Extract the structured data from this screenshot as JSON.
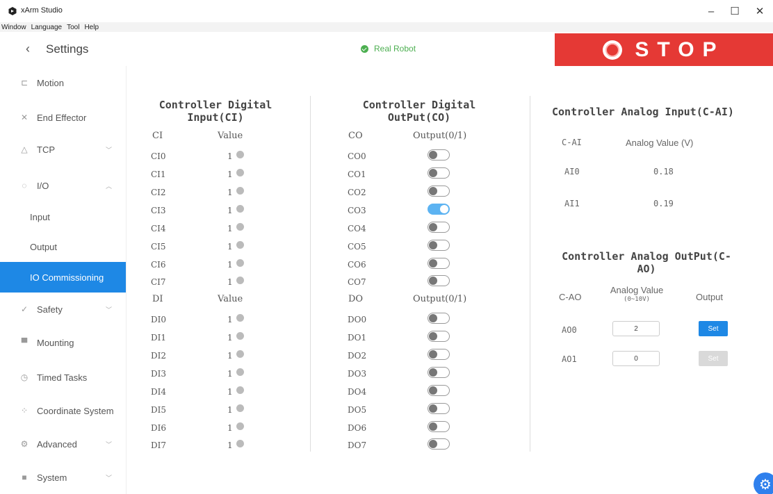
{
  "window": {
    "title": "xArm Studio",
    "min": "–",
    "max": "☐",
    "close": "✕"
  },
  "menu": [
    "Window",
    "Language",
    "Tool",
    "Help"
  ],
  "header": {
    "back": "‹",
    "title": "Settings",
    "status": "Real Robot",
    "stop_label": "STOP"
  },
  "colors": {
    "accent": "#1e88e5",
    "stop": "#e53935",
    "status_ok": "#4caf50",
    "toggle_on": "#5cb3f2"
  },
  "sidebar": {
    "items": [
      {
        "label": "Motion",
        "icon": "motion-icon",
        "glyph": "⊏"
      },
      {
        "label": "End Effector",
        "icon": "end-effector-icon",
        "glyph": "✕"
      },
      {
        "label": "TCP",
        "icon": "tcp-icon",
        "glyph": "△",
        "chevron": "﹀"
      },
      {
        "label": "I/O",
        "icon": "io-icon",
        "glyph": "◌",
        "chevron": "︿"
      },
      {
        "label": "Safety",
        "icon": "safety-icon",
        "glyph": "✓",
        "chevron": "﹀"
      },
      {
        "label": "Mounting",
        "icon": "mounting-icon",
        "glyph": "▀"
      },
      {
        "label": "Timed Tasks",
        "icon": "timed-tasks-icon",
        "glyph": "◷"
      },
      {
        "label": "Coordinate System",
        "icon": "coordinate-icon",
        "glyph": "⁘"
      },
      {
        "label": "Advanced",
        "icon": "advanced-icon",
        "glyph": "⚙",
        "chevron": "﹀"
      },
      {
        "label": "System",
        "icon": "system-icon",
        "glyph": "■",
        "chevron": "﹀"
      }
    ],
    "io_sub": [
      "Input",
      "Output",
      "IO Commissioning"
    ]
  },
  "ci": {
    "heading": "Controller Digital Input(CI)",
    "heading_lines": [
      "Controller Digital",
      "Input(CI)"
    ],
    "header1": "CI",
    "header2": "Value",
    "rows": [
      {
        "name": "CI0",
        "value": "1"
      },
      {
        "name": "CI1",
        "value": "1"
      },
      {
        "name": "CI2",
        "value": "1"
      },
      {
        "name": "CI3",
        "value": "1"
      },
      {
        "name": "CI4",
        "value": "1"
      },
      {
        "name": "CI5",
        "value": "1"
      },
      {
        "name": "CI6",
        "value": "1"
      },
      {
        "name": "CI7",
        "value": "1"
      }
    ],
    "dheader1": "DI",
    "dheader2": "Value",
    "drows": [
      {
        "name": "DI0",
        "value": "1"
      },
      {
        "name": "DI1",
        "value": "1"
      },
      {
        "name": "DI2",
        "value": "1"
      },
      {
        "name": "DI3",
        "value": "1"
      },
      {
        "name": "DI4",
        "value": "1"
      },
      {
        "name": "DI5",
        "value": "1"
      },
      {
        "name": "DI6",
        "value": "1"
      },
      {
        "name": "DI7",
        "value": "1"
      }
    ]
  },
  "co": {
    "heading_lines": [
      "Controller Digital",
      "OutPut(CO)"
    ],
    "header1": "CO",
    "header2": "Output(0/1)",
    "rows": [
      {
        "name": "CO0",
        "on": false
      },
      {
        "name": "CO1",
        "on": false
      },
      {
        "name": "CO2",
        "on": false
      },
      {
        "name": "CO3",
        "on": true
      },
      {
        "name": "CO4",
        "on": false
      },
      {
        "name": "CO5",
        "on": false
      },
      {
        "name": "CO6",
        "on": false
      },
      {
        "name": "CO7",
        "on": false
      }
    ],
    "dheader1": "DO",
    "dheader2": "Output(0/1)",
    "drows": [
      {
        "name": "DO0",
        "on": false
      },
      {
        "name": "DO1",
        "on": false
      },
      {
        "name": "DO2",
        "on": false
      },
      {
        "name": "DO3",
        "on": false
      },
      {
        "name": "DO4",
        "on": false
      },
      {
        "name": "DO5",
        "on": false
      },
      {
        "name": "DO6",
        "on": false
      },
      {
        "name": "DO7",
        "on": false
      }
    ]
  },
  "ai": {
    "heading": "Controller Analog Input(C-AI)",
    "header1": "C-AI",
    "header2": "Analog Value (V)",
    "rows": [
      {
        "name": "AI0",
        "value": "0.18"
      },
      {
        "name": "AI1",
        "value": "0.19"
      }
    ]
  },
  "ao": {
    "heading_lines": [
      "Controller Analog OutPut(C-",
      "AO)"
    ],
    "header1": "C-AO",
    "header2": "Analog Value",
    "header2_sub": "(0~10V)",
    "header3": "Output",
    "rows": [
      {
        "name": "AO0",
        "value": "2",
        "set": "Set",
        "enabled": true
      },
      {
        "name": "AO1",
        "value": "0",
        "set": "Set",
        "enabled": false
      }
    ]
  }
}
